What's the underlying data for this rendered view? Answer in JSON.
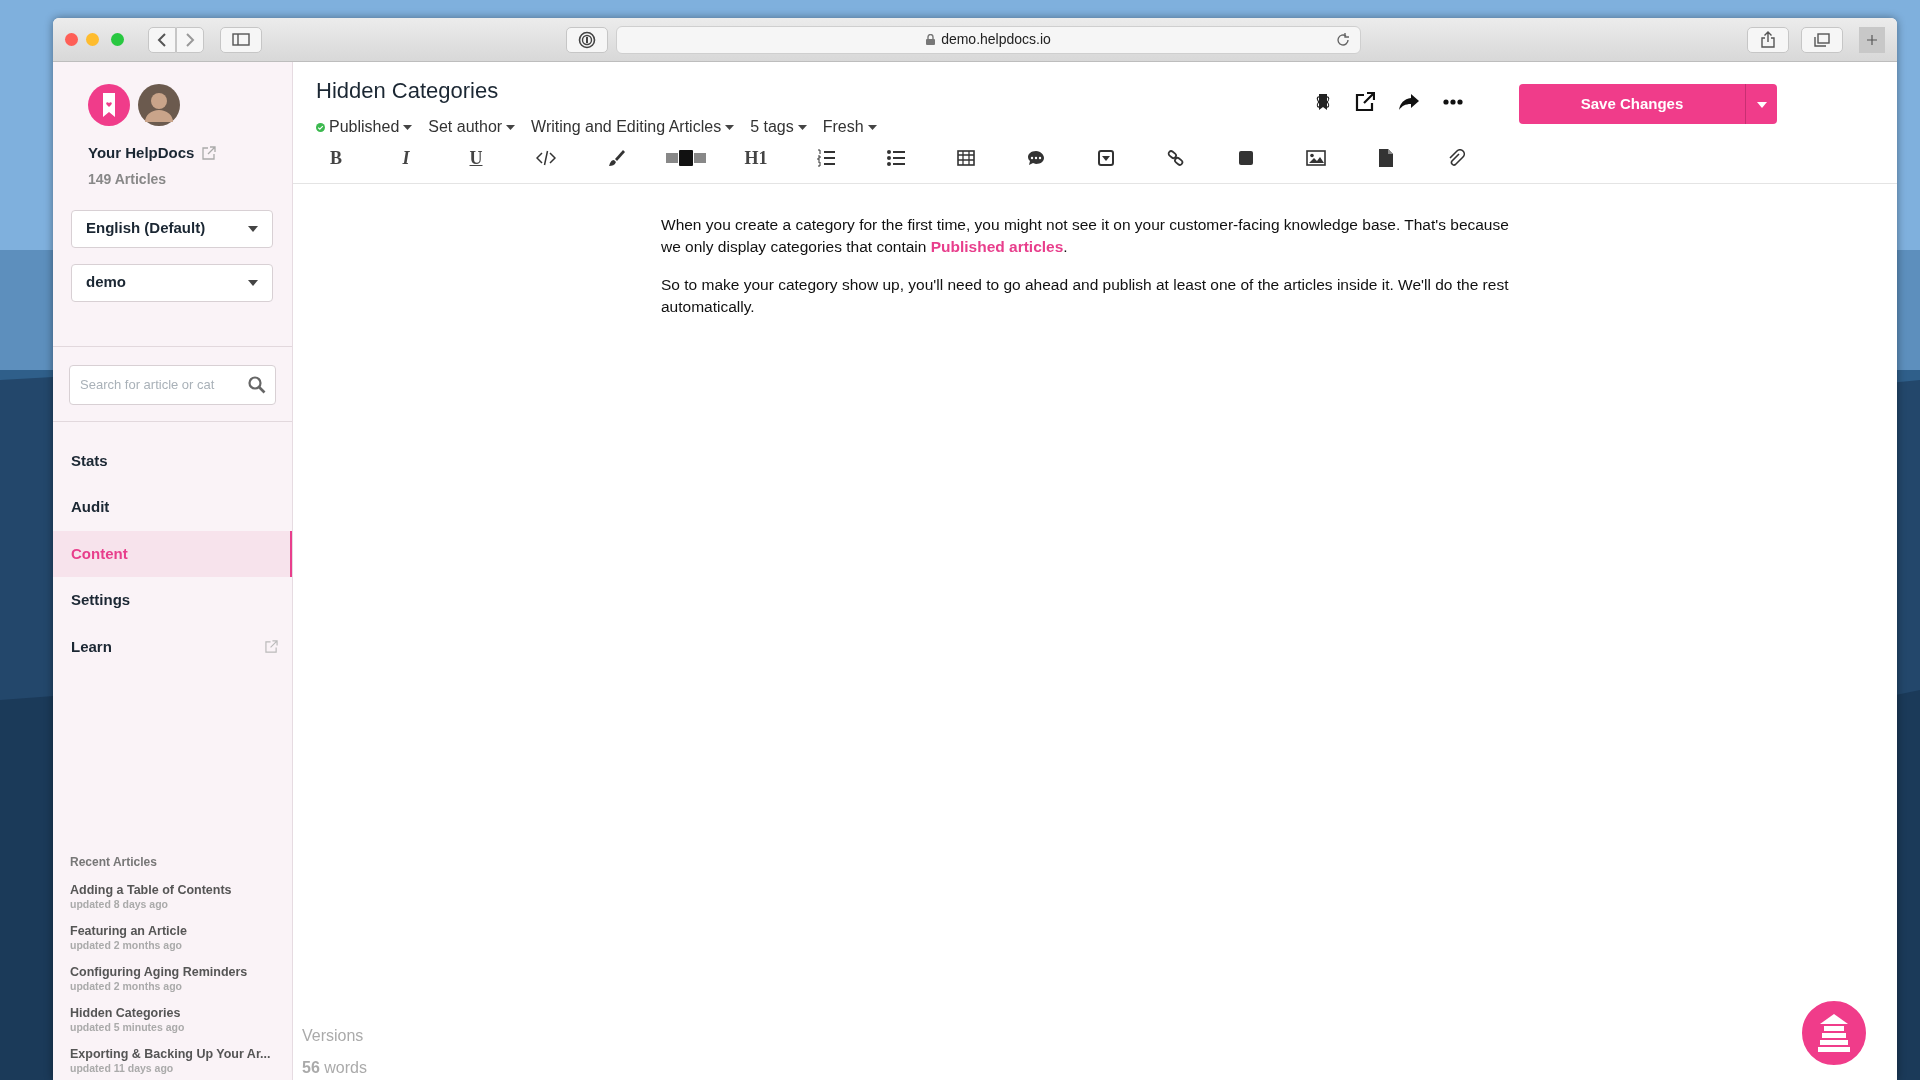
{
  "browser": {
    "url": "demo.helpdocs.io"
  },
  "sidebar": {
    "site_name": "Your HelpDocs",
    "article_count": "149 Articles",
    "language": "English (Default)",
    "workspace": "demo",
    "search": {
      "placeholder": "Search for article or cat"
    },
    "nav": [
      {
        "label": "Stats",
        "selected": false,
        "external": false
      },
      {
        "label": "Audit",
        "selected": false,
        "external": false
      },
      {
        "label": "Content",
        "selected": true,
        "external": false
      },
      {
        "label": "Settings",
        "selected": false,
        "external": false
      },
      {
        "label": "Learn",
        "selected": false,
        "external": true
      }
    ],
    "recent_heading": "Recent Articles",
    "recent": [
      {
        "title": "Adding a Table of Contents",
        "updated": "updated 8 days ago"
      },
      {
        "title": "Featuring an Article",
        "updated": "updated 2 months ago"
      },
      {
        "title": "Configuring Aging Reminders",
        "updated": "updated 2 months ago"
      },
      {
        "title": "Hidden Categories",
        "updated": "updated 5 minutes ago"
      },
      {
        "title": "Exporting & Backing Up Your Ar...",
        "updated": "updated 11 days ago"
      }
    ]
  },
  "article": {
    "title": "Hidden Categories",
    "meta": [
      {
        "label": "Published",
        "color": "#3cb94f"
      },
      {
        "label": "Set author"
      },
      {
        "label": "Writing and Editing Articles"
      },
      {
        "label": "5 tags"
      },
      {
        "label": "Fresh"
      }
    ],
    "save_button": "Save Changes",
    "toolbar": [
      {
        "kind": "glyph",
        "text": "B"
      },
      {
        "kind": "glyph",
        "text": "I"
      },
      {
        "kind": "glyph",
        "text": "U"
      },
      {
        "kind": "icon"
      },
      {
        "kind": "icon"
      },
      {
        "kind": "icon"
      },
      {
        "kind": "glyph",
        "text": "H1"
      },
      {
        "kind": "icon"
      },
      {
        "kind": "icon"
      },
      {
        "kind": "icon"
      },
      {
        "kind": "icon"
      },
      {
        "kind": "icon"
      },
      {
        "kind": "icon"
      },
      {
        "kind": "icon"
      },
      {
        "kind": "icon"
      },
      {
        "kind": "icon"
      },
      {
        "kind": "icon"
      }
    ],
    "paragraphs": [
      [
        {
          "kind": "text",
          "text": "When you create a category for the first time, you might not see it on your customer-facing knowledge base. That's because we only display categories that contain "
        },
        {
          "kind": "link",
          "text": "Published articles"
        },
        {
          "kind": "text",
          "text": "."
        }
      ],
      [
        {
          "kind": "text",
          "text": "So to make your category show up, you'll need to go ahead and publish at least one of the articles inside it. We'll do the rest automatically."
        }
      ]
    ],
    "versions": "Versions",
    "word_count": "56",
    "word_label": "words"
  }
}
